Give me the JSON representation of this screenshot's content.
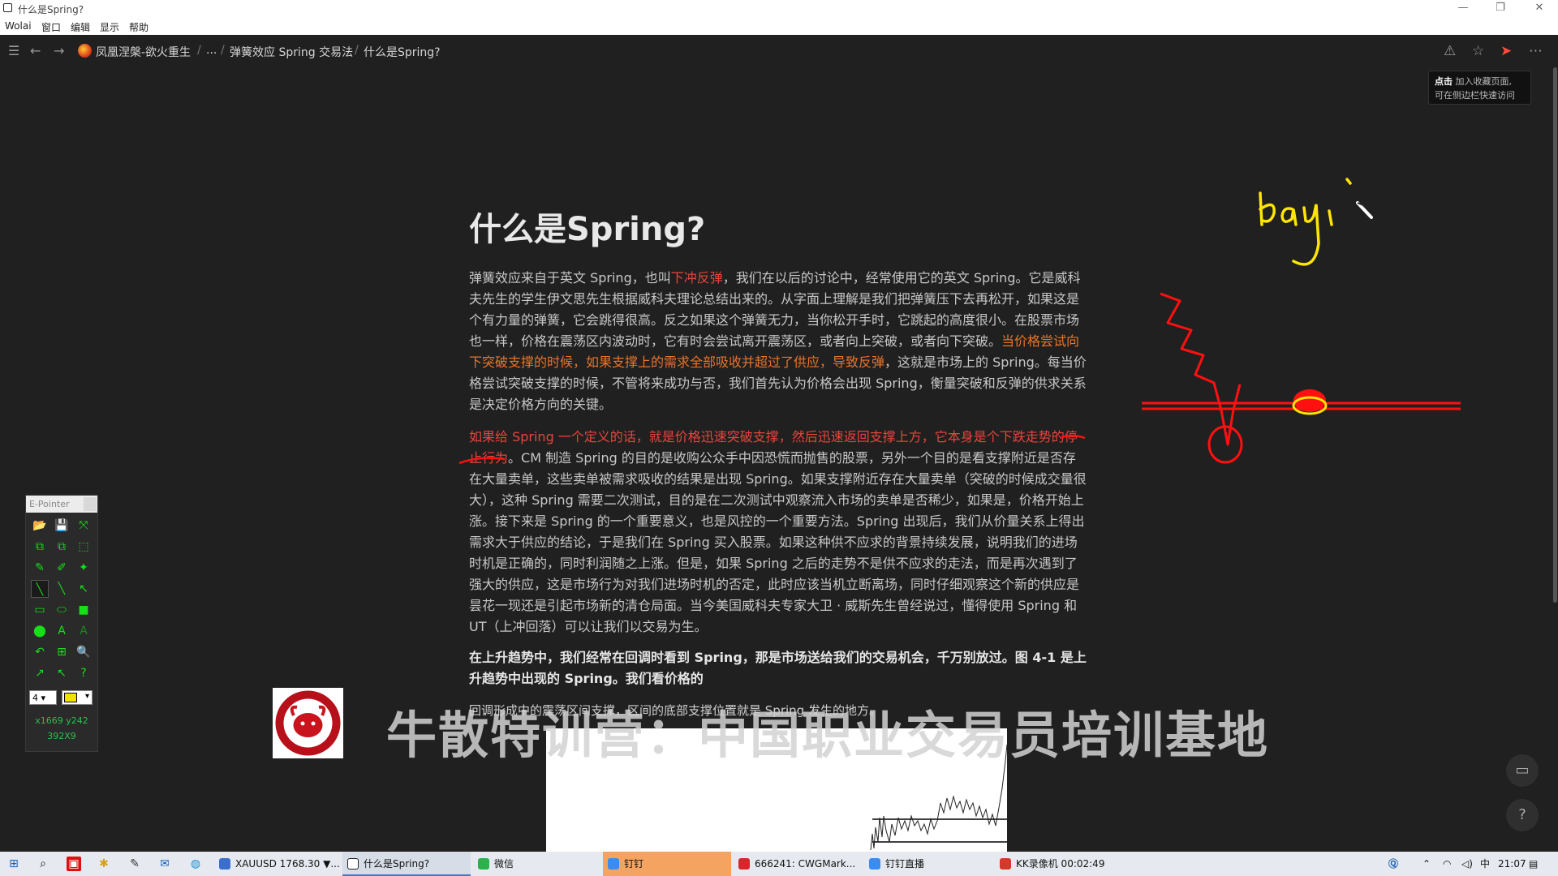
{
  "window": {
    "title": "什么是Spring?",
    "minimize": "—",
    "maximize": "❐",
    "close": "✕"
  },
  "menubar": {
    "items": [
      "Wolai",
      "窗口",
      "编辑",
      "显示",
      "帮助"
    ]
  },
  "nav": {
    "menu_icon": "☰",
    "back_icon": "←",
    "forward_icon": "→",
    "breadcrumbs": [
      "凤凰涅槃-欲火重生",
      "...",
      "弹簧效应 Spring 交易法",
      "什么是Spring?"
    ],
    "separator": "/",
    "right_icons": [
      "share-icon",
      "star-icon",
      "send-icon",
      "more-icon"
    ]
  },
  "tooltip": {
    "bold": "点击",
    "line1": "加入收藏页面,",
    "line2": "可在侧边栏快速访问"
  },
  "document": {
    "title": "什么是Spring?",
    "p1": {
      "a": "弹簧效应来自于英文 Spring，也叫",
      "b_red": "下冲反弹",
      "c": "，我们在以后的讨论中，经常使用它的英文 Spring。它是威科夫先生的学生伊文思先生根据威科夫理论总结出来的。从字面上理解是我们把弹簧压下去再松开，如果这是个有力量的弹簧，它会跳得很高。反之如果这个弹簧无力，当你松开手时，它跳起的高度很小。在股票市场也一样，价格在震荡区内波动时，它有时会尝试离开震荡区，或者向上突破，或者向下突破。",
      "d_orange": "当价格尝试向下突破支撑的时候，如果支撑上的需求全部吸收并超过了供应，导致反弹",
      "e": "，这就是市场上的 Spring。每当价格尝试突破支撑的时候，不管将来成功与否，我们首先认为价格会出现 Spring，衡量突破和反弹的供求关系是决定价格方向的关键。"
    },
    "p2": {
      "a_red": "如果给 Spring 一个定义的话，就是价格迅速突破支撑，然后迅速返回支撑上方，它本身是个下跌走势的停止行为",
      "b": "。CM 制造 Spring 的目的是收购公众手中因恐慌而抛售的股票，另外一个目的是看支撑附近是否存在大量卖单，这些卖单被需求吸收的结果是出现 Spring。如果支撑附近存在大量卖单（突破的时候成交量很大），这种 Spring 需要二次测试，目的是在二次测试中观察流入市场的卖单是否稀少，如果是，价格开始上涨。接下来是 Spring 的一个重要意义，也是风控的一个重要方法。Spring 出现后，我们从价量关系上得出需求大于供应的结论，于是我们在 Spring 买入股票。如果这种供不应求的背景持续发展，说明我们的进场时机是正确的，同时利润随之上涨。但是，如果 Spring 之后的走势不是供不应求的走法，而是再次遇到了强大的供应，这是市场行为对我们进场时机的否定，此时应该当机立断离场，同时仔细观察这个新的供应是昙花一现还是引起市场新的清仓局面。当今美国威科夫专家大卫 · 威斯先生曾经说过，懂得使用 Spring 和 UT（上冲回落）可以让我们以交易为生。"
    },
    "p3": "在上升趋势中，我们经常在回调时看到 Spring，那是市场送给我们的交易机会，千万别放过。图 4-1 是上升趋势中出现的 Spring。我们看价格的",
    "p4": "回调形成中的震荡区间支撑，区间的底部支撑位置就是 Spring 发生的地方。"
  },
  "annotation": {
    "handwriting": "bayi"
  },
  "epointer": {
    "title": "E-Pointer",
    "tools": [
      "📂",
      "💾",
      "⤧",
      "⧉",
      "⧉",
      "⬚",
      "✎",
      "✐",
      "✦",
      "╲",
      "╲",
      "↖",
      "▭",
      "⬭",
      "■",
      "⬤",
      "A",
      "A",
      "↶",
      "⊞",
      "🔍",
      "↗",
      "↖",
      "?"
    ],
    "size_value": "4",
    "coords": "x1669 y242",
    "dims": "392X9"
  },
  "watermark": {
    "text": "牛散特训营：中国职业交易员培训基地",
    "logo_text": "牛散特训营"
  },
  "float_buttons": {
    "comment": "▭",
    "help": "?"
  },
  "taskbar": {
    "tasks": [
      {
        "label": "XAUUSD 1768.30 ▼...",
        "color": "#3c6ecf"
      },
      {
        "label": "什么是Spring?",
        "color": "#222222"
      },
      {
        "label": "微信",
        "color": "#2bb24c"
      },
      {
        "label": "钉钉",
        "color": "#3a8cf0"
      },
      {
        "label": "666241: CWGMark...",
        "color": "#d9262b"
      },
      {
        "label": "钉钉直播",
        "color": "#3a8cf0"
      },
      {
        "label": "KK录像机 00:02:49",
        "color": "#d23b2b"
      }
    ],
    "clock": "21:07",
    "tray_icons": [
      "q-icon",
      "chevron-up-icon",
      "network-icon",
      "volume-icon"
    ]
  },
  "colors": {
    "background": "#202020",
    "red_text": "#e8453c",
    "orange_text": "#e9742b",
    "annotation_red": "#ff1010",
    "annotation_yellow": "#ffe600",
    "epointer_green": "#17e017"
  }
}
